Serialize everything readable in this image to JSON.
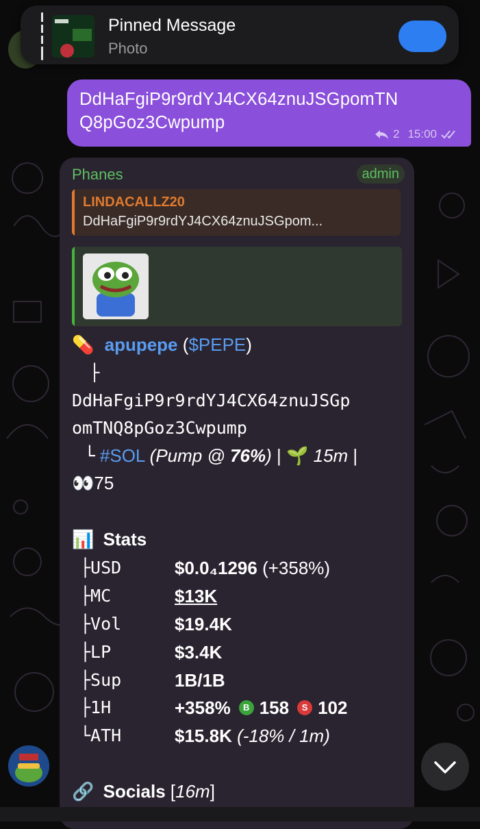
{
  "pinned": {
    "title": "Pinned Message",
    "subtitle": "Photo"
  },
  "outgoing": {
    "line1": "DdHaFgiP9r9rdYJ4CX64znuJSGpomTN",
    "line2": "Q8pGoz3Cwpump",
    "reply_count": "2",
    "time": "15:00"
  },
  "incoming": {
    "sender": "Phanes",
    "role": "admin",
    "reply_name": "LINDACALLZ20",
    "reply_text": "DdHaFgiP9r9rdYJ4CX64znuJSGpom...",
    "token_emoji": "💊",
    "token_name": "apupepe",
    "token_open": "(",
    "token_symbol": "$PEPE",
    "token_close": ")",
    "tree_branch": "├",
    "address_line1": "DdHaFgiP9r9rdYJ4CX64znuJSGp",
    "address_line2": "omTNQ8pGoz3Cwpump",
    "tree_end": "└",
    "chain_tag": "#SOL",
    "pump_prefix": "(Pump @ ",
    "pump_pct": "76%",
    "pump_suffix": ")",
    "sep": " | ",
    "age_emoji": "🌱",
    "age": "15m",
    "sep2": " |",
    "eyes_emoji": "👀",
    "views": "75",
    "stats_emoji": "📊",
    "stats_title": "Stats",
    "stats": [
      {
        "key": "├USD",
        "value": "$0.0₄1296",
        "extra": " (+358%)"
      },
      {
        "key": "├MC",
        "value": "$13K"
      },
      {
        "key": "├Vol",
        "value": "$19.4K"
      },
      {
        "key": "├LP",
        "value": "$3.4K"
      },
      {
        "key": "├Sup",
        "value": "1B/1B"
      },
      {
        "key": "├1H",
        "value": "+358%",
        "buys_badge": "B",
        "buys": "158",
        "sells_badge": "S",
        "sells": "102"
      },
      {
        "key": "└ATH",
        "value": "$15.8K",
        "extra": " (-18% / 1m)"
      }
    ],
    "socials_emoji": "🔗",
    "socials_title": "Socials",
    "socials_age_open": " [",
    "socials_age": "16m",
    "socials_age_close": "]"
  },
  "colors": {
    "outgoing_bubble": "#8a4fdb",
    "incoming_bubble": "#2a2430",
    "sender": "#5fbf61",
    "reply_accent": "#e07a2f",
    "link": "#5a9cf0",
    "pin_button": "#2c7ef1"
  }
}
